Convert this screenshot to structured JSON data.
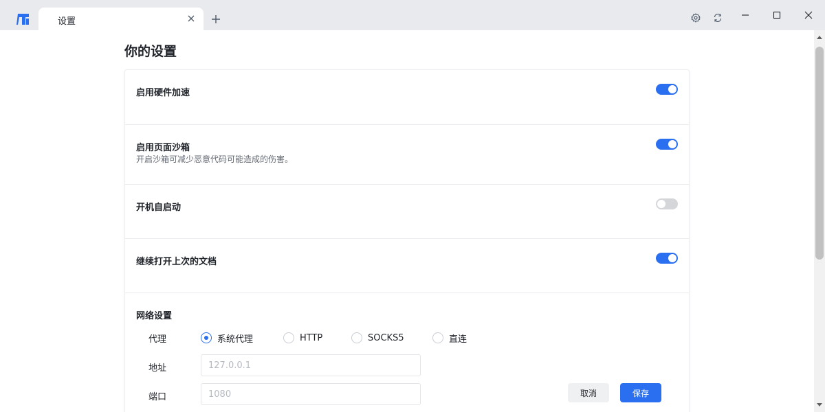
{
  "window": {
    "tab_title": "设置"
  },
  "icons": {
    "app_logo": "app-logo-icon",
    "tab_close": "close-icon",
    "new_tab": "plus-icon",
    "settings": "gear-icon",
    "refresh": "refresh-icon",
    "minimize": "minimize-icon",
    "maximize": "maximize-icon",
    "close": "close-icon"
  },
  "colors": {
    "accent": "#2a6ff0",
    "toggle_off": "#d4d6da",
    "titlebar_bg": "#e8eaed"
  },
  "page": {
    "title": "你的设置"
  },
  "settings": [
    {
      "title": "启用硬件加速",
      "description": "",
      "enabled": true
    },
    {
      "title": "启用页面沙箱",
      "description": "开启沙箱可减少恶意代码可能造成的伤害。",
      "enabled": true
    },
    {
      "title": "开机自启动",
      "description": "",
      "enabled": false
    },
    {
      "title": "继续打开上次的文档",
      "description": "",
      "enabled": true
    }
  ],
  "network": {
    "section_title": "网络设置",
    "proxy_label": "代理",
    "proxy_options": [
      "系统代理",
      "HTTP",
      "SOCKS5",
      "直连"
    ],
    "proxy_selected": "系统代理",
    "address_label": "地址",
    "address_placeholder": "127.0.0.1",
    "port_label": "端口",
    "port_placeholder": "1080"
  },
  "actions": {
    "cancel_label": "取消",
    "save_label": "保存"
  }
}
